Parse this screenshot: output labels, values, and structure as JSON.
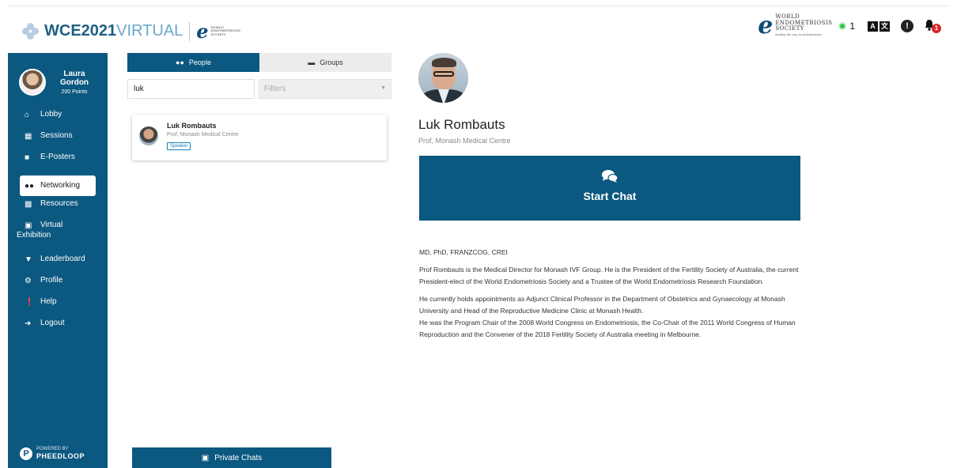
{
  "header": {
    "brand_wce": "WCE",
    "brand_year": "2021",
    "brand_virtual": "VIRTUAL",
    "brand_small": "WORLD ENDOMETRIOSIS SOCIETY",
    "partner_logo_text": "WORLD ENDOMETRIOSIS SOCIETY",
    "partner_logo_tagline": "leading the way in endometriosis",
    "online_count": "1",
    "notification_count": "1"
  },
  "sidebar": {
    "user": {
      "first_name": "Laura",
      "last_name": "Gordon",
      "points": "200 Points"
    },
    "items": [
      {
        "label": "Lobby",
        "icon": "home-icon"
      },
      {
        "label": "Sessions",
        "icon": "calendar-icon"
      },
      {
        "label": "E-Posters",
        "icon": "video-icon"
      },
      {
        "label": "Networking",
        "icon": "users-icon",
        "active": true
      },
      {
        "label": "Resources",
        "icon": "resources-icon"
      },
      {
        "label_line1": "Virtual",
        "label_line2": "Exhibition",
        "icon": "exhibition-icon"
      },
      {
        "label": "Leaderboard",
        "icon": "trophy-icon"
      },
      {
        "label": "Profile",
        "icon": "gear-icon"
      },
      {
        "label": "Help",
        "icon": "info-icon"
      },
      {
        "label": "Logout",
        "icon": "logout-icon"
      }
    ],
    "powered_by": "POWERED BY",
    "powered_brand": "PHEEDLOOP"
  },
  "people_panel": {
    "tabs": [
      {
        "label": "People",
        "active": true
      },
      {
        "label": "Groups",
        "active": false
      }
    ],
    "search_value": "luk",
    "filters_placeholder": "Filters",
    "results": [
      {
        "name": "Luk Rombauts",
        "affiliation": "Prof, Monash Medical Centre",
        "badge": "Speaker"
      }
    ],
    "private_chats_label": "Private Chats"
  },
  "profile": {
    "name": "Luk Rombauts",
    "affiliation": "Prof, Monash Medical Centre",
    "start_chat_label": "Start Chat",
    "bio": [
      "MD, PhD, FRANZCOG, CREI",
      "Prof Rombauts is the Medical Director for Monash IVF Group. He is the President of the Fertility Society of Australia, the current President-elect of the World Endometriosis Society and a Trustee of the World Endometriosis Research Foundation.",
      "He currently holds appointments as Adjunct Clinical Professor in the Department of Obstetrics and Gynaecology at Monash University and Head of the Reproductive Medicine Clinic at Monash Health.",
      "He was the Program Chair of the 2008 World Congress on Endometriosis, the Co-Chair of the 2011 World Congress of Human Reproduction and the Convener of the 2018 Fertility Society of Australia meeting in Melbourne."
    ]
  },
  "colors": {
    "primary": "#0b5880",
    "online": "#35c34a",
    "badge": "#d9262c"
  }
}
